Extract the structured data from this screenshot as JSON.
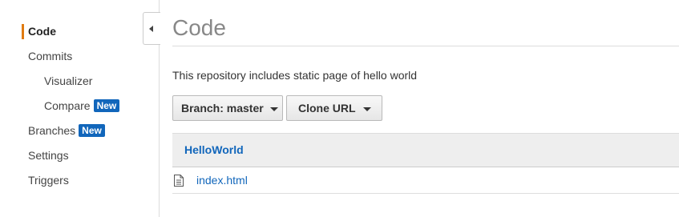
{
  "sidebar": {
    "items": [
      {
        "label": "Code",
        "active": true
      },
      {
        "label": "Commits"
      },
      {
        "label": "Visualizer"
      },
      {
        "label": "Compare",
        "badge": "New"
      },
      {
        "label": "Branches",
        "badge": "New"
      },
      {
        "label": "Settings"
      },
      {
        "label": "Triggers"
      }
    ]
  },
  "main": {
    "title": "Code",
    "description": "This repository includes static page of hello world",
    "branch_button": "Branch: master",
    "clone_button": "Clone URL",
    "repo_name": "HelloWorld",
    "files": [
      {
        "name": "index.html",
        "icon": "file-icon"
      }
    ]
  },
  "colors": {
    "accent": "#e07b12",
    "link": "#1166bb",
    "badge": "#1166bb"
  },
  "icons": {
    "collapse": "chevron-left-icon",
    "dropdown": "caret-down-icon",
    "file": "file-icon"
  }
}
